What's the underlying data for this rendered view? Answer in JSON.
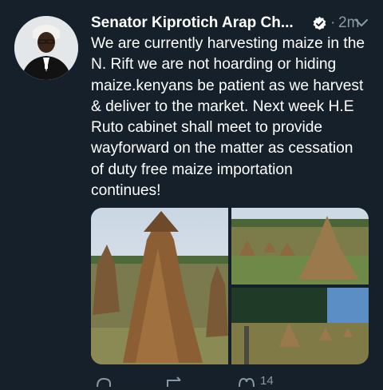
{
  "tweet": {
    "author_name": "Senator Kiprotich Arap Ch...",
    "separator": "·",
    "timestamp": "2m",
    "text": "We are currently harvesting maize in the\nN. Rift we are not hoarding or hiding\nmaize.kenyans be patient as we harvest\n& deliver to the market. Next week H.E\nRuto cabinet shall meet to provide\nwayforward on the matter as cessation\nof duty free maize importation\ncontinues!",
    "actions": {
      "like_count": "14"
    }
  },
  "colors": {
    "background": "#15202b",
    "text": "#ffffff",
    "muted": "#8899a6"
  },
  "icons": [
    "verified-icon",
    "chevron-down-icon",
    "reply-icon",
    "retweet-icon",
    "like-icon"
  ]
}
